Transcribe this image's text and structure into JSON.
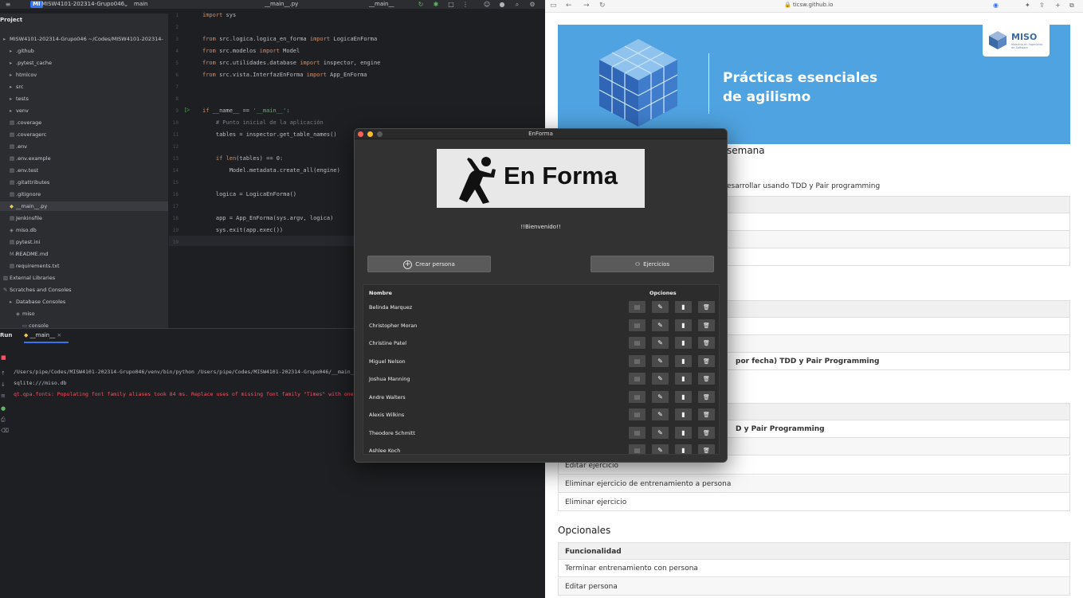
{
  "ide": {
    "project_badge": "MI",
    "project_name": "MISW4101-202314-Grupo046",
    "branch": "main",
    "open_file_tab": "__main__.py",
    "run_config": "__main__",
    "project_panel_title": "Project",
    "tree": [
      {
        "label": "MISW4101-202314-Grupo046 ~/Codes/MISW4101-202314-",
        "icon": "folder-icon",
        "level": 0
      },
      {
        "label": ".github",
        "icon": "folder-icon",
        "level": 1
      },
      {
        "label": ".pytest_cache",
        "icon": "folder-icon",
        "level": 1
      },
      {
        "label": "htmlcov",
        "icon": "folder-icon",
        "level": 1
      },
      {
        "label": "src",
        "icon": "folder-icon",
        "level": 1
      },
      {
        "label": "tests",
        "icon": "folder-icon",
        "level": 1
      },
      {
        "label": "venv",
        "icon": "folder-icon",
        "level": 1
      },
      {
        "label": ".coverage",
        "icon": "file-icon",
        "level": 1
      },
      {
        "label": ".coveragerc",
        "icon": "file-icon",
        "level": 1
      },
      {
        "label": ".env",
        "icon": "file-icon",
        "level": 1
      },
      {
        "label": ".env.example",
        "icon": "file-icon",
        "level": 1
      },
      {
        "label": ".env.test",
        "icon": "file-icon",
        "level": 1
      },
      {
        "label": ".gitattributes",
        "icon": "file-icon",
        "level": 1
      },
      {
        "label": ".gitignore",
        "icon": "file-icon",
        "level": 1
      },
      {
        "label": "__main__.py",
        "icon": "python-file-icon",
        "level": 1
      },
      {
        "label": "Jenkinsfile",
        "icon": "file-icon",
        "level": 1
      },
      {
        "label": "miso.db",
        "icon": "database-icon",
        "level": 1
      },
      {
        "label": "pytest.ini",
        "icon": "file-icon",
        "level": 1
      },
      {
        "label": "README.md",
        "icon": "markdown-file-icon",
        "level": 1
      },
      {
        "label": "requirements.txt",
        "icon": "file-icon",
        "level": 1
      },
      {
        "label": "External Libraries",
        "icon": "library-icon",
        "level": 0
      },
      {
        "label": "Scratches and Consoles",
        "icon": "scratch-icon",
        "level": 0
      },
      {
        "label": "Database Consoles",
        "icon": "folder-icon",
        "level": 1
      },
      {
        "label": "miso",
        "icon": "database-icon",
        "level": 2
      },
      {
        "label": "console",
        "icon": "console-icon",
        "level": 3
      }
    ],
    "code": [
      {
        "n": "1",
        "text": "import sys"
      },
      {
        "n": "2",
        "text": ""
      },
      {
        "n": "3",
        "text": "from src.logica.logica_en_forma import LogicaEnForma"
      },
      {
        "n": "4",
        "text": "from src.modelos import Model"
      },
      {
        "n": "5",
        "text": "from src.utilidades.database import inspector, engine"
      },
      {
        "n": "6",
        "text": "from src.vista.InterfazEnForma import App_EnForma"
      },
      {
        "n": "7",
        "text": ""
      },
      {
        "n": "8",
        "text": ""
      },
      {
        "n": "9",
        "text": "if __name__ == '__main__':"
      },
      {
        "n": "10",
        "text": "    # Punto inicial de la aplicación"
      },
      {
        "n": "11",
        "text": "    tables = inspector.get_table_names()"
      },
      {
        "n": "12",
        "text": ""
      },
      {
        "n": "13",
        "text": "    if len(tables) == 0:"
      },
      {
        "n": "14",
        "text": "        Model.metadata.create_all(engine)"
      },
      {
        "n": "15",
        "text": ""
      },
      {
        "n": "16",
        "text": "    logica = LogicaEnForma()"
      },
      {
        "n": "17",
        "text": ""
      },
      {
        "n": "18",
        "text": "    app = App_EnForma(sys.argv, logica)"
      },
      {
        "n": "19",
        "text": "    sys.exit(app.exec())"
      },
      {
        "n": "19",
        "text": ""
      }
    ],
    "run": {
      "title": "Run",
      "tab": "__main__",
      "lines": [
        "/Users/pipe/Codes/MISW4101-202314-Grupo046/venv/bin/python /Users/pipe/Codes/MISW4101-202314-Grupo046/__main__",
        "sqlite:///miso.db",
        "qt.qpa.fonts: Populating font family aliases took 84 ms. Replace uses of missing font family \"Times\" with one t"
      ]
    },
    "colors": {
      "keyword": "#cf8e6d",
      "string": "#6aab73",
      "comment": "#7a7e85",
      "function": "#56a8f5",
      "error_text": "#f75464",
      "accent": "#3574f0"
    }
  },
  "browser": {
    "url": "ticsw.github.io",
    "banner": {
      "title_line1": "Prácticas esenciales",
      "title_line2": "de agilismo",
      "logo_text": "MISO",
      "logo_sub": "Maestría en Ingeniería de Software"
    },
    "fragments": [
      {
        "text": "semana",
        "kind": "heading"
      },
      {
        "text": "esarrollar usando TDD y Pair programming",
        "kind": "text"
      },
      {
        "text": "por fecha) TDD y Pair Programming",
        "kind": "text"
      },
      {
        "text": "D y Pair Programming",
        "kind": "text"
      }
    ],
    "rows_after_window": [
      "Editar ejercicio",
      "Eliminar ejercicio de entrenamiento a persona",
      "Eliminar ejercicio"
    ],
    "optional_heading": "Opcionales",
    "optional_table": {
      "header": "Funcionalidad",
      "rows": [
        "Terminar entrenamiento con persona",
        "Editar persona"
      ]
    }
  },
  "app": {
    "window_title": "EnForma",
    "logo_text": "En Forma",
    "welcome": "!!Bienvenido!!",
    "create_button": "Crear persona",
    "exercises_button": "Ejercicios",
    "table": {
      "col_name": "Nombre",
      "col_options": "Opciones",
      "rows": [
        "Belinda Marquez",
        "Christopher Moran",
        "Christine Patel",
        "Miguel Nelson",
        "Joshua Manning",
        "Andre Walters",
        "Alexis Wilkins",
        "Theodore Schmitt",
        "Ashlee Koch"
      ],
      "action_icons": [
        "report-icon",
        "edit-icon",
        "delete-training-icon",
        "trash-icon"
      ]
    }
  }
}
